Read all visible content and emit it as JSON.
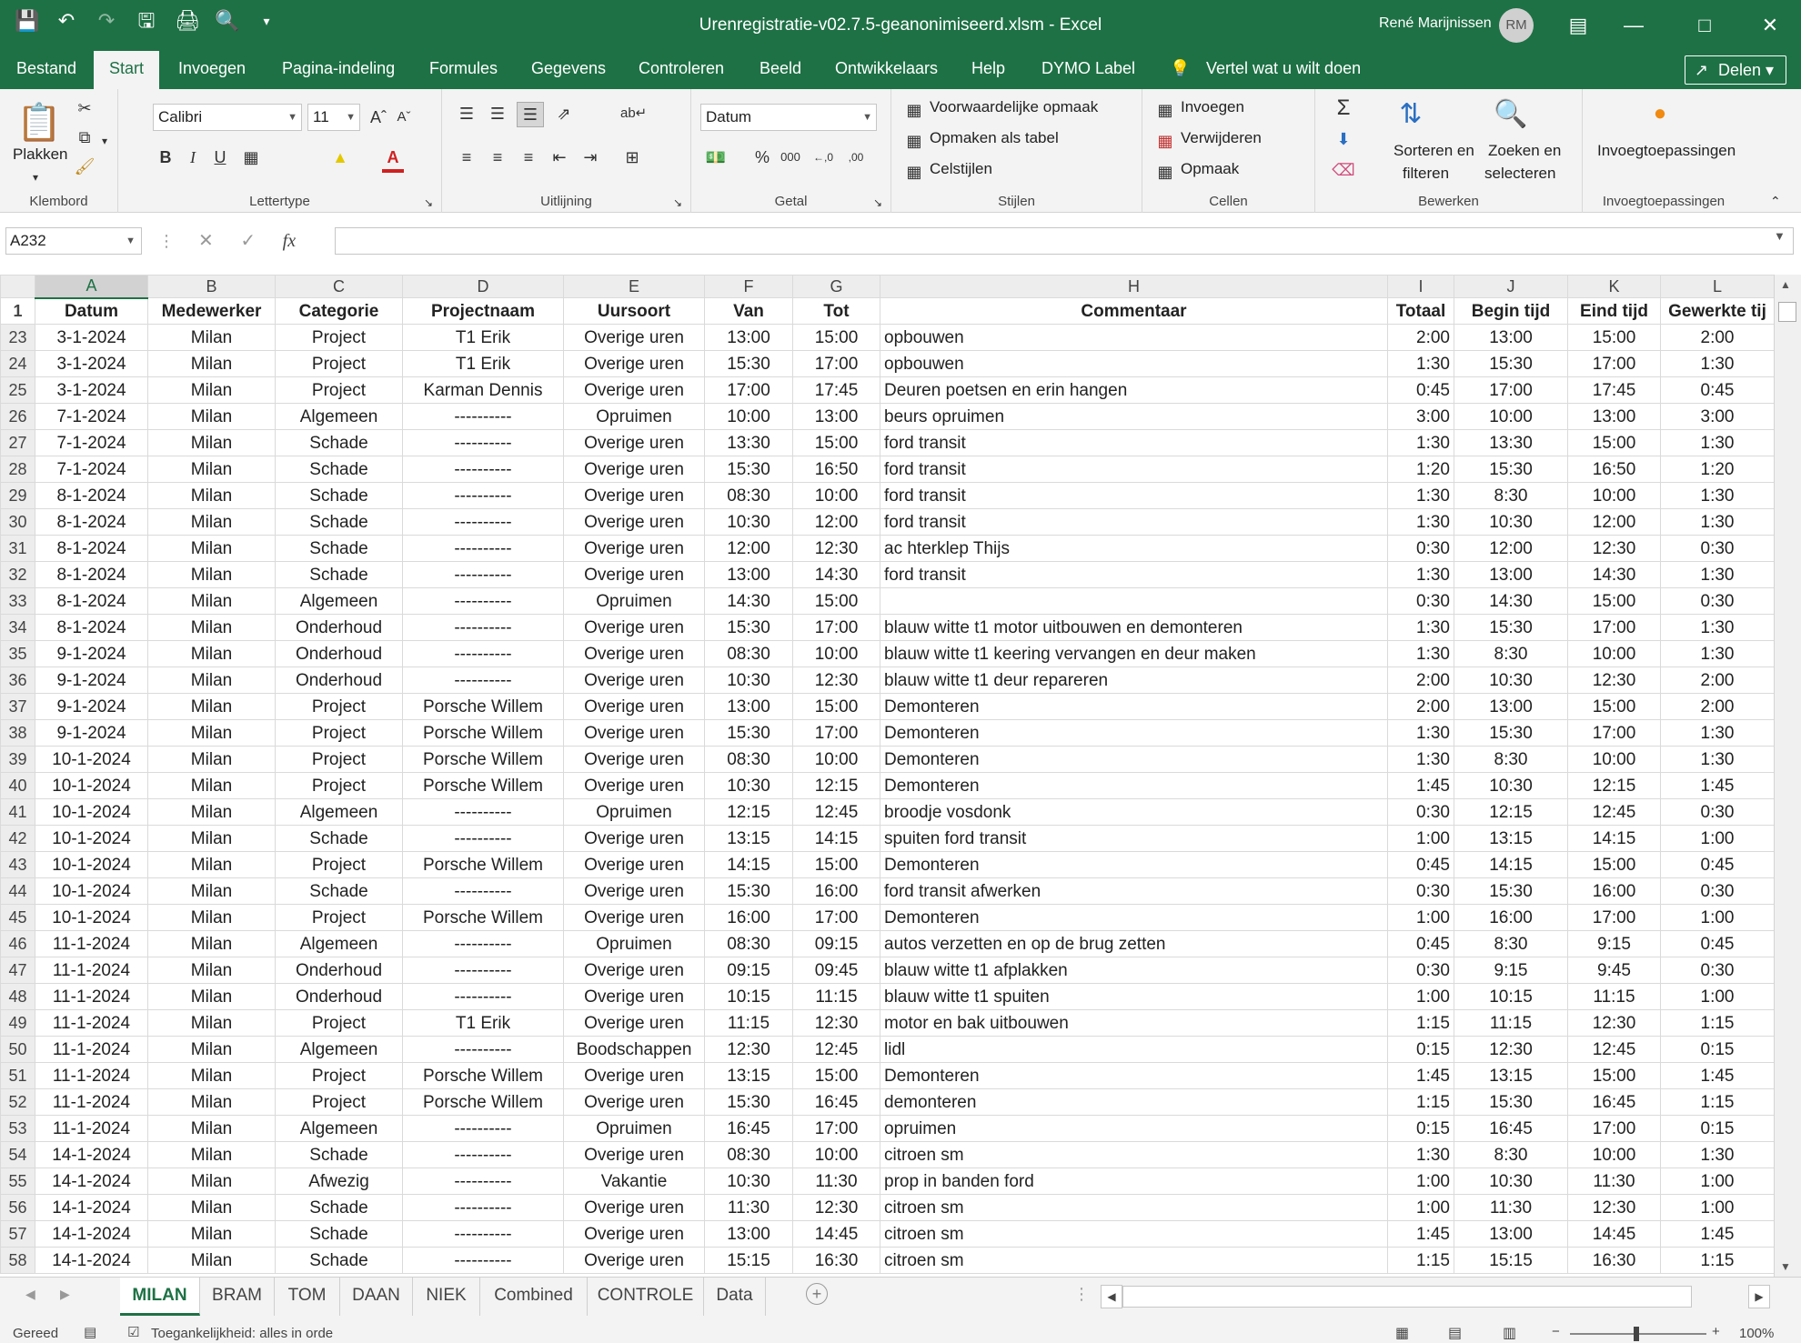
{
  "window": {
    "title": "Urenregistratie-v02.7.5-geanonimiseerd.xlsm  -  Excel",
    "user": "René Marijnissen",
    "user_initials": "RM"
  },
  "menu": {
    "tabs": [
      "Bestand",
      "Start",
      "Invoegen",
      "Pagina-indeling",
      "Formules",
      "Gegevens",
      "Controleren",
      "Beeld",
      "Ontwikkelaars",
      "Help",
      "DYMO Label"
    ],
    "tell_me": "Vertel wat u wilt doen",
    "share": "Delen"
  },
  "ribbon": {
    "clipboard": {
      "label": "Klembord",
      "paste": "Plakken"
    },
    "font": {
      "label": "Lettertype",
      "name": "Calibri",
      "size": "11"
    },
    "alignment": {
      "label": "Uitlijning"
    },
    "number": {
      "label": "Getal",
      "format": "Datum"
    },
    "styles": {
      "label": "Stijlen",
      "conditional": "Voorwaardelijke opmaak",
      "as_table": "Opmaken als tabel",
      "cell_styles": "Celstijlen"
    },
    "cells": {
      "label": "Cellen",
      "insert": "Invoegen",
      "delete": "Verwijderen",
      "format": "Opmaak"
    },
    "editing": {
      "label": "Bewerken",
      "sort_l1": "Sorteren en",
      "sort_l2": "filteren",
      "find_l1": "Zoeken en",
      "find_l2": "selecteren"
    },
    "addins": {
      "label": "Invoegtoepassingen",
      "button": "Invoegtoepassingen"
    }
  },
  "formula_bar": {
    "name_box": "A232",
    "fx": "fx",
    "value": ""
  },
  "columns": [
    "A",
    "B",
    "C",
    "D",
    "E",
    "F",
    "G",
    "H",
    "I",
    "J",
    "K",
    "L"
  ],
  "headers": [
    "Datum",
    "Medewerker",
    "Categorie",
    "Projectnaam",
    "Uursoort",
    "Van",
    "Tot",
    "Commentaar",
    "Totaal",
    "Begin tijd",
    "Eind tijd",
    "Gewerkte tij"
  ],
  "rows": [
    [
      "23",
      "3-1-2024",
      "Milan",
      "Project",
      "T1 Erik",
      "Overige uren",
      "13:00",
      "15:00",
      "opbouwen",
      "2:00",
      "13:00",
      "15:00",
      "2:00"
    ],
    [
      "24",
      "3-1-2024",
      "Milan",
      "Project",
      "T1 Erik",
      "Overige uren",
      "15:30",
      "17:00",
      "opbouwen",
      "1:30",
      "15:30",
      "17:00",
      "1:30"
    ],
    [
      "25",
      "3-1-2024",
      "Milan",
      "Project",
      "Karman Dennis",
      "Overige uren",
      "17:00",
      "17:45",
      "Deuren poetsen en erin hangen",
      "0:45",
      "17:00",
      "17:45",
      "0:45"
    ],
    [
      "26",
      "7-1-2024",
      "Milan",
      "Algemeen",
      "----------",
      "Opruimen",
      "10:00",
      "13:00",
      "beurs opruimen",
      "3:00",
      "10:00",
      "13:00",
      "3:00"
    ],
    [
      "27",
      "7-1-2024",
      "Milan",
      "Schade",
      "----------",
      "Overige uren",
      "13:30",
      "15:00",
      "ford transit",
      "1:30",
      "13:30",
      "15:00",
      "1:30"
    ],
    [
      "28",
      "7-1-2024",
      "Milan",
      "Schade",
      "----------",
      "Overige uren",
      "15:30",
      "16:50",
      "ford transit",
      "1:20",
      "15:30",
      "16:50",
      "1:20"
    ],
    [
      "29",
      "8-1-2024",
      "Milan",
      "Schade",
      "----------",
      "Overige uren",
      "08:30",
      "10:00",
      "ford transit",
      "1:30",
      "8:30",
      "10:00",
      "1:30"
    ],
    [
      "30",
      "8-1-2024",
      "Milan",
      "Schade",
      "----------",
      "Overige uren",
      "10:30",
      "12:00",
      "ford transit",
      "1:30",
      "10:30",
      "12:00",
      "1:30"
    ],
    [
      "31",
      "8-1-2024",
      "Milan",
      "Schade",
      "----------",
      "Overige uren",
      "12:00",
      "12:30",
      "ac hterklep Thijs",
      "0:30",
      "12:00",
      "12:30",
      "0:30"
    ],
    [
      "32",
      "8-1-2024",
      "Milan",
      "Schade",
      "----------",
      "Overige uren",
      "13:00",
      "14:30",
      "ford transit",
      "1:30",
      "13:00",
      "14:30",
      "1:30"
    ],
    [
      "33",
      "8-1-2024",
      "Milan",
      "Algemeen",
      "----------",
      "Opruimen",
      "14:30",
      "15:00",
      "",
      "0:30",
      "14:30",
      "15:00",
      "0:30"
    ],
    [
      "34",
      "8-1-2024",
      "Milan",
      "Onderhoud",
      "----------",
      "Overige uren",
      "15:30",
      "17:00",
      "blauw witte t1 motor uitbouwen en demonteren",
      "1:30",
      "15:30",
      "17:00",
      "1:30"
    ],
    [
      "35",
      "9-1-2024",
      "Milan",
      "Onderhoud",
      "----------",
      "Overige uren",
      "08:30",
      "10:00",
      "blauw witte t1 keering vervangen en deur maken",
      "1:30",
      "8:30",
      "10:00",
      "1:30"
    ],
    [
      "36",
      "9-1-2024",
      "Milan",
      "Onderhoud",
      "----------",
      "Overige uren",
      "10:30",
      "12:30",
      "blauw witte t1 deur repareren",
      "2:00",
      "10:30",
      "12:30",
      "2:00"
    ],
    [
      "37",
      "9-1-2024",
      "Milan",
      "Project",
      "Porsche Willem",
      "Overige uren",
      "13:00",
      "15:00",
      "Demonteren",
      "2:00",
      "13:00",
      "15:00",
      "2:00"
    ],
    [
      "38",
      "9-1-2024",
      "Milan",
      "Project",
      "Porsche Willem",
      "Overige uren",
      "15:30",
      "17:00",
      "Demonteren",
      "1:30",
      "15:30",
      "17:00",
      "1:30"
    ],
    [
      "39",
      "10-1-2024",
      "Milan",
      "Project",
      "Porsche Willem",
      "Overige uren",
      "08:30",
      "10:00",
      "Demonteren",
      "1:30",
      "8:30",
      "10:00",
      "1:30"
    ],
    [
      "40",
      "10-1-2024",
      "Milan",
      "Project",
      "Porsche Willem",
      "Overige uren",
      "10:30",
      "12:15",
      "Demonteren",
      "1:45",
      "10:30",
      "12:15",
      "1:45"
    ],
    [
      "41",
      "10-1-2024",
      "Milan",
      "Algemeen",
      "----------",
      "Opruimen",
      "12:15",
      "12:45",
      "broodje vosdonk",
      "0:30",
      "12:15",
      "12:45",
      "0:30"
    ],
    [
      "42",
      "10-1-2024",
      "Milan",
      "Schade",
      "----------",
      "Overige uren",
      "13:15",
      "14:15",
      "spuiten ford transit",
      "1:00",
      "13:15",
      "14:15",
      "1:00"
    ],
    [
      "43",
      "10-1-2024",
      "Milan",
      "Project",
      "Porsche Willem",
      "Overige uren",
      "14:15",
      "15:00",
      "Demonteren",
      "0:45",
      "14:15",
      "15:00",
      "0:45"
    ],
    [
      "44",
      "10-1-2024",
      "Milan",
      "Schade",
      "----------",
      "Overige uren",
      "15:30",
      "16:00",
      "ford transit afwerken",
      "0:30",
      "15:30",
      "16:00",
      "0:30"
    ],
    [
      "45",
      "10-1-2024",
      "Milan",
      "Project",
      "Porsche Willem",
      "Overige uren",
      "16:00",
      "17:00",
      "Demonteren",
      "1:00",
      "16:00",
      "17:00",
      "1:00"
    ],
    [
      "46",
      "11-1-2024",
      "Milan",
      "Algemeen",
      "----------",
      "Opruimen",
      "08:30",
      "09:15",
      "autos verzetten en op de brug zetten",
      "0:45",
      "8:30",
      "9:15",
      "0:45"
    ],
    [
      "47",
      "11-1-2024",
      "Milan",
      "Onderhoud",
      "----------",
      "Overige uren",
      "09:15",
      "09:45",
      "blauw witte t1 afplakken",
      "0:30",
      "9:15",
      "9:45",
      "0:30"
    ],
    [
      "48",
      "11-1-2024",
      "Milan",
      "Onderhoud",
      "----------",
      "Overige uren",
      "10:15",
      "11:15",
      "blauw witte t1 spuiten",
      "1:00",
      "10:15",
      "11:15",
      "1:00"
    ],
    [
      "49",
      "11-1-2024",
      "Milan",
      "Project",
      "T1 Erik",
      "Overige uren",
      "11:15",
      "12:30",
      "motor en bak uitbouwen",
      "1:15",
      "11:15",
      "12:30",
      "1:15"
    ],
    [
      "50",
      "11-1-2024",
      "Milan",
      "Algemeen",
      "----------",
      "Boodschappen",
      "12:30",
      "12:45",
      "lidl",
      "0:15",
      "12:30",
      "12:45",
      "0:15"
    ],
    [
      "51",
      "11-1-2024",
      "Milan",
      "Project",
      "Porsche Willem",
      "Overige uren",
      "13:15",
      "15:00",
      "Demonteren",
      "1:45",
      "13:15",
      "15:00",
      "1:45"
    ],
    [
      "52",
      "11-1-2024",
      "Milan",
      "Project",
      "Porsche Willem",
      "Overige uren",
      "15:30",
      "16:45",
      "demonteren",
      "1:15",
      "15:30",
      "16:45",
      "1:15"
    ],
    [
      "53",
      "11-1-2024",
      "Milan",
      "Algemeen",
      "----------",
      "Opruimen",
      "16:45",
      "17:00",
      "opruimen",
      "0:15",
      "16:45",
      "17:00",
      "0:15"
    ],
    [
      "54",
      "14-1-2024",
      "Milan",
      "Schade",
      "----------",
      "Overige uren",
      "08:30",
      "10:00",
      "citroen sm",
      "1:30",
      "8:30",
      "10:00",
      "1:30"
    ],
    [
      "55",
      "14-1-2024",
      "Milan",
      "Afwezig",
      "----------",
      "Vakantie",
      "10:30",
      "11:30",
      "prop in banden ford",
      "1:00",
      "10:30",
      "11:30",
      "1:00"
    ],
    [
      "56",
      "14-1-2024",
      "Milan",
      "Schade",
      "----------",
      "Overige uren",
      "11:30",
      "12:30",
      "citroen sm",
      "1:00",
      "11:30",
      "12:30",
      "1:00"
    ],
    [
      "57",
      "14-1-2024",
      "Milan",
      "Schade",
      "----------",
      "Overige uren",
      "13:00",
      "14:45",
      "citroen sm",
      "1:45",
      "13:00",
      "14:45",
      "1:45"
    ],
    [
      "58",
      "14-1-2024",
      "Milan",
      "Schade",
      "----------",
      "Overige uren",
      "15:15",
      "16:30",
      "citroen sm",
      "1:15",
      "15:15",
      "16:30",
      "1:15"
    ]
  ],
  "sheets": [
    "MILAN",
    "BRAM",
    "TOM",
    "DAAN",
    "NIEK",
    "Combined",
    "CONTROLE",
    "Data"
  ],
  "status": {
    "ready": "Gereed",
    "accessibility": "Toegankelijkheid: alles in orde",
    "zoom": "100%"
  }
}
